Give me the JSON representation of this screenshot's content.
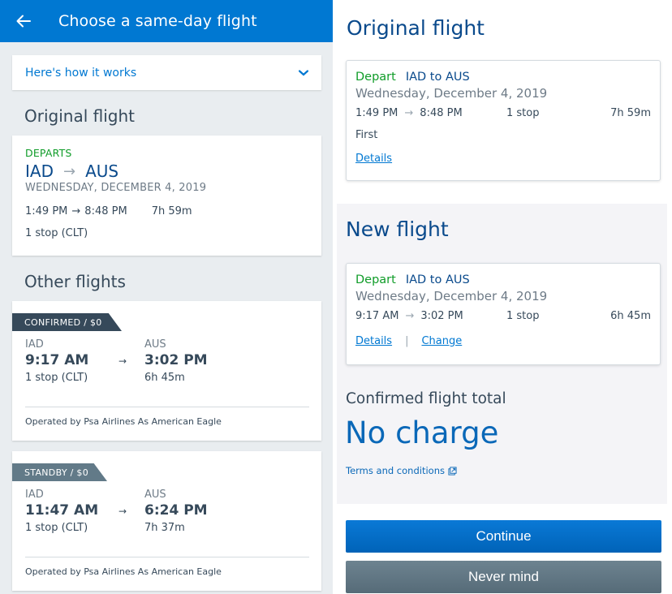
{
  "left": {
    "appbar": {
      "title": "Choose a same-day flight",
      "back_icon": "arrow-left-icon"
    },
    "how_it_works": {
      "label": "Here's how it works",
      "icon": "chevron-down-icon"
    },
    "original_flight": {
      "heading": "Original flight",
      "departs_label": "DEPARTS",
      "origin": "IAD",
      "destination": "AUS",
      "date": "WEDNESDAY, DECEMBER 4, 2019",
      "depart_time": "1:49 PM",
      "arrive_time": "8:48 PM",
      "duration": "7h 59m",
      "stops": "1 stop (CLT)"
    },
    "other_flights": {
      "heading": "Other flights",
      "flights": [
        {
          "badge": "CONFIRMED / $0",
          "origin": "IAD",
          "destination": "AUS",
          "depart_time": "9:17 AM",
          "arrive_time": "3:02 PM",
          "stops": "1 stop (CLT)",
          "duration": "6h 45m",
          "operator": "Operated by Psa Airlines As American Eagle"
        },
        {
          "badge": "STANDBY / $0",
          "origin": "IAD",
          "destination": "AUS",
          "depart_time": "11:47 AM",
          "arrive_time": "6:24 PM",
          "stops": "1 stop (CLT)",
          "duration": "7h 37m",
          "operator": "Operated by Psa Airlines As American Eagle"
        }
      ]
    }
  },
  "right": {
    "original": {
      "heading": "Original flight",
      "depart_label": "Depart",
      "route": "IAD to AUS",
      "date": "Wednesday, December 4, 2019",
      "depart_time": "1:49 PM",
      "arrive_time": "8:48 PM",
      "stops": "1 stop",
      "duration": "7h 59m",
      "cabin": "First",
      "details_link": "Details"
    },
    "new": {
      "heading": "New flight",
      "depart_label": "Depart",
      "route": "IAD to AUS",
      "date": "Wednesday, December 4, 2019",
      "depart_time": "9:17 AM",
      "arrive_time": "3:02 PM",
      "stops": "1 stop",
      "duration": "6h 45m",
      "details_link": "Details",
      "separator": "|",
      "change_link": "Change"
    },
    "total": {
      "label": "Confirmed flight total",
      "value": "No charge",
      "terms_link": "Terms and conditions"
    },
    "buttons": {
      "continue": "Continue",
      "never_mind": "Never mind"
    }
  },
  "arrow_glyph": "→",
  "colors": {
    "brand_blue": "#0078d2",
    "navy": "#0a4a8c",
    "green": "#0f9c28",
    "slate": "#36495a",
    "standby_grey": "#627a88"
  }
}
